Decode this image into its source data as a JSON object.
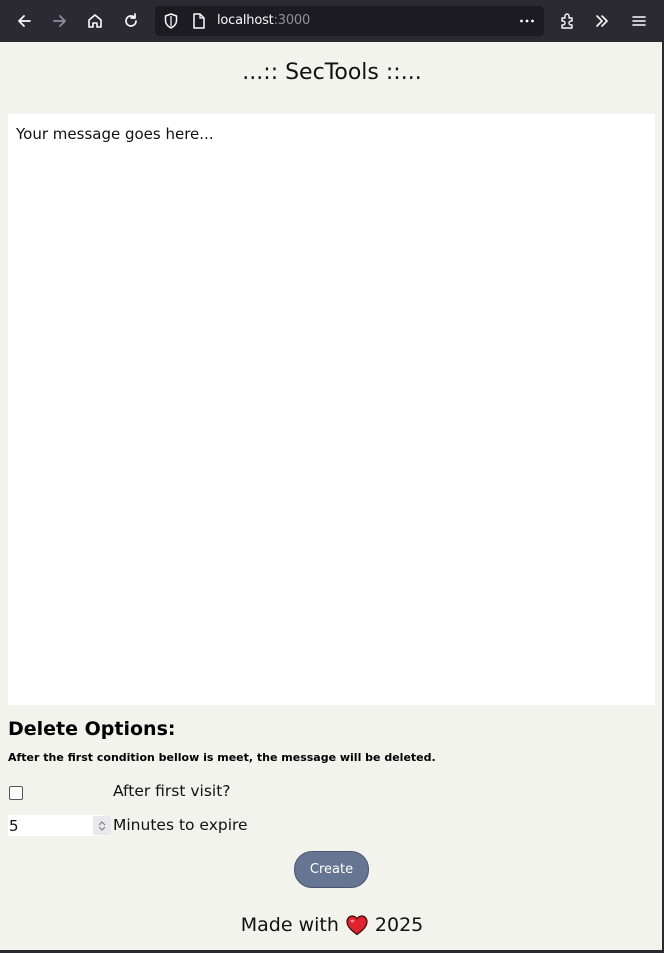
{
  "browser": {
    "url_host": "localhost",
    "url_port": ":3000",
    "icons": [
      "back-icon",
      "forward-icon",
      "home-icon",
      "reload-icon",
      "shield-icon",
      "page-icon",
      "more-icon",
      "extensions-icon",
      "overflow-icon",
      "menu-icon"
    ]
  },
  "page": {
    "title": "...:: SecTools ::...",
    "message_placeholder": "Your message goes here..."
  },
  "delete_options": {
    "heading": "Delete Options:",
    "note": "After the first condition bellow is meet, the message will be deleted.",
    "first_visit_label": "After first visit?",
    "first_visit_checked": false,
    "minutes_value": "5",
    "minutes_label": "Minutes to expire"
  },
  "actions": {
    "create_label": "Create"
  },
  "footer": {
    "prefix": "Made with",
    "year": "2025",
    "heart_color": "#e0212e"
  },
  "colors": {
    "page_bg": "#f3f3ee",
    "button_bg": "#667591",
    "toolbar_bg": "#2b2a33"
  }
}
